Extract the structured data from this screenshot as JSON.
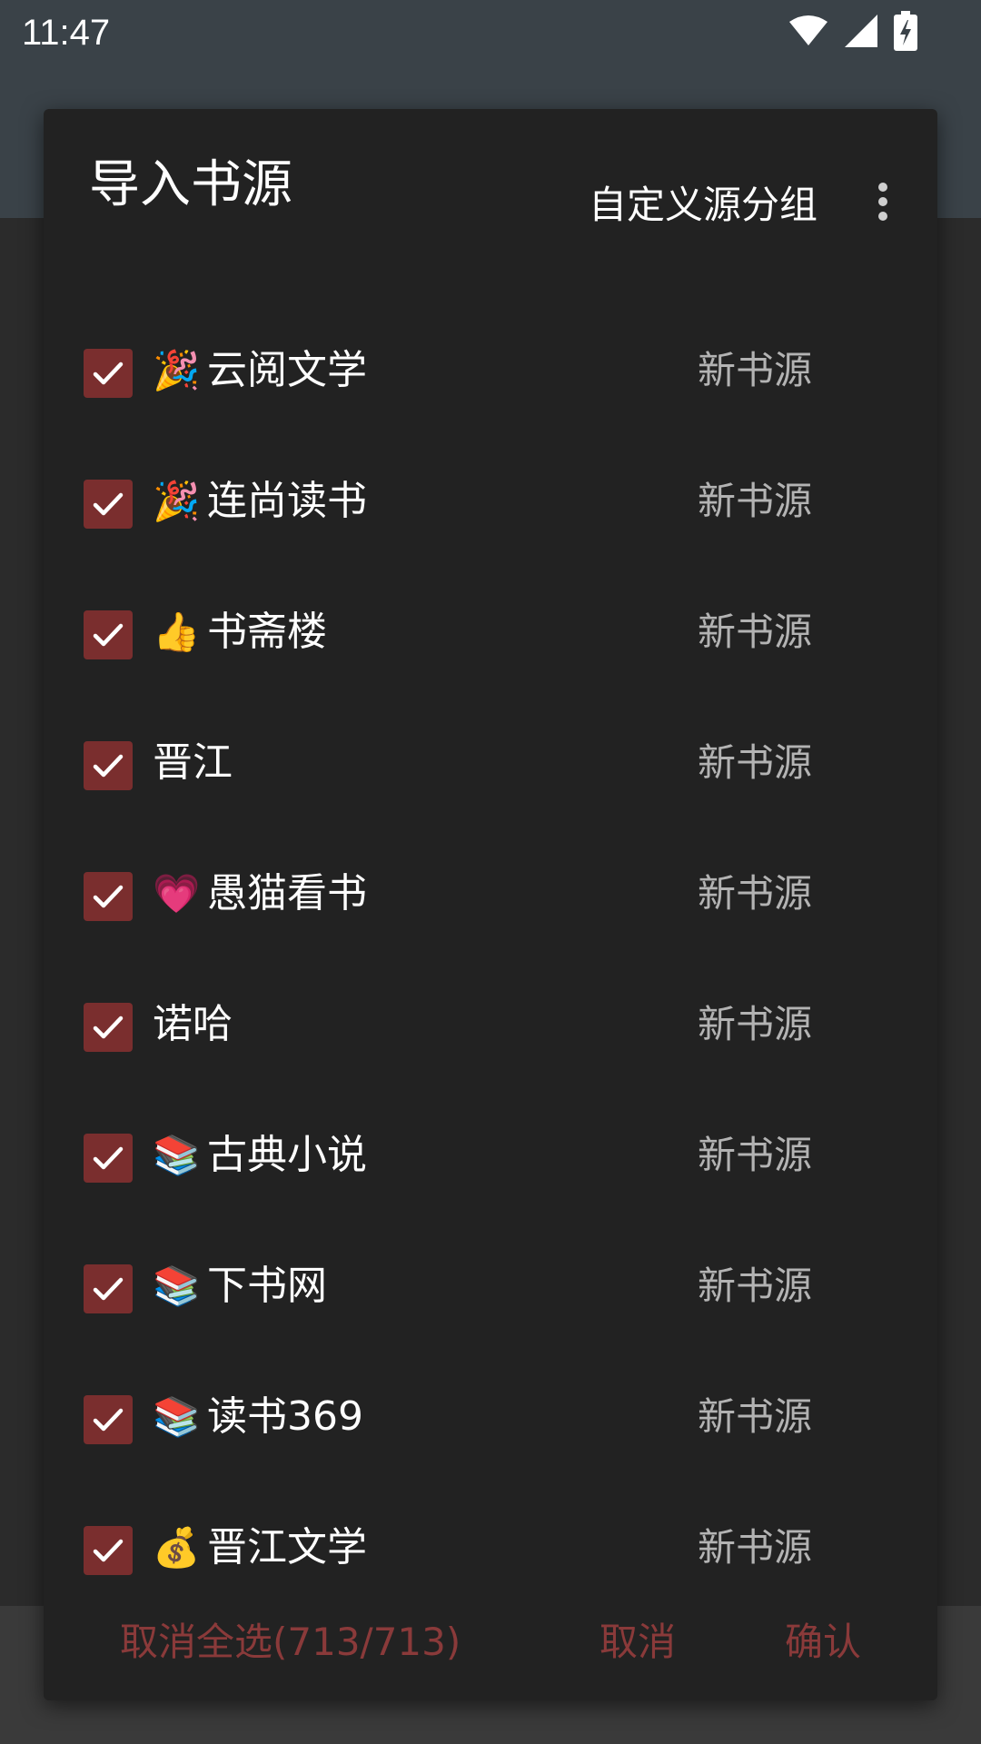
{
  "status_bar": {
    "time": "11:47",
    "icons": [
      "wifi-icon",
      "signal-icon",
      "battery-charging-icon"
    ]
  },
  "dialog": {
    "title": "导入书源",
    "group_button_label": "自定义源分组",
    "more_icon": "more-vert-icon",
    "items": [
      {
        "emoji": "🎉",
        "name": "云阅文学",
        "status": "新书源",
        "checked": true
      },
      {
        "emoji": "🎉",
        "name": "连尚读书",
        "status": "新书源",
        "checked": true
      },
      {
        "emoji": "👍",
        "name": "书斋楼",
        "status": "新书源",
        "checked": true
      },
      {
        "emoji": "",
        "name": "晋江",
        "status": "新书源",
        "checked": true
      },
      {
        "emoji": "💗",
        "name": "愚猫看书",
        "status": "新书源",
        "checked": true
      },
      {
        "emoji": "",
        "name": "诺哈",
        "status": "新书源",
        "checked": true
      },
      {
        "emoji": "📚",
        "name": "古典小说",
        "status": "新书源",
        "checked": true
      },
      {
        "emoji": "📚",
        "name": "下书网",
        "status": "新书源",
        "checked": true
      },
      {
        "emoji": "📚",
        "name": "读书369",
        "status": "新书源",
        "checked": true
      },
      {
        "emoji": "💰",
        "name": "晋江文学",
        "status": "新书源",
        "checked": true
      }
    ],
    "footer": {
      "deselect_all_label": "取消全选(713/713)",
      "cancel_label": "取消",
      "confirm_label": "确认"
    }
  },
  "colors": {
    "dialog_bg": "#222222",
    "checkbox_fill": "#7a2e2e",
    "accent_text": "#8a3a3a",
    "secondary_text": "#b3b3b3"
  }
}
